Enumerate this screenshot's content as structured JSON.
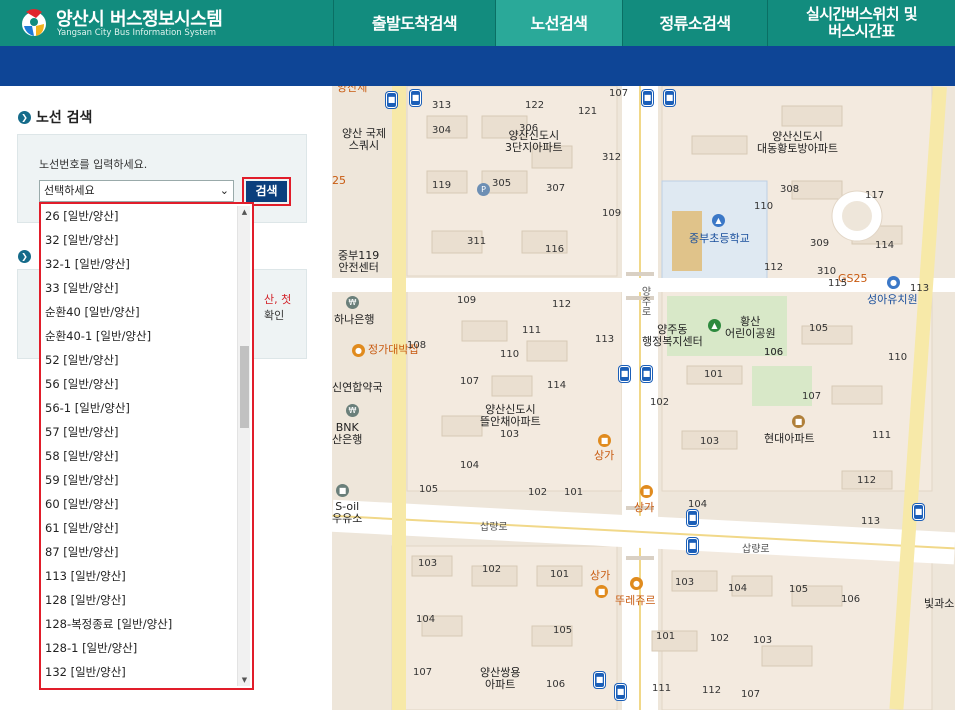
{
  "header": {
    "logo_title": "양산시 버스정보시스템",
    "logo_subtitle": "Yangsan City Bus Information System",
    "nav": [
      {
        "label": "출발도착검색",
        "active": false
      },
      {
        "label": "노선검색",
        "active": true
      },
      {
        "label": "정류소검색",
        "active": false
      },
      {
        "label": "실시간버스위치 및\n버스시간표",
        "active": false
      }
    ]
  },
  "route_search": {
    "section_title": "노선 검색",
    "input_label": "노선번호를 입력하세요.",
    "selected": "선택하세요",
    "search_button": "검색",
    "options": [
      "26 [일반/양산]",
      "32 [일반/양산]",
      "32-1 [일반/양산]",
      "33 [일반/양산]",
      "순환40 [일반/양산]",
      "순환40-1 [일반/양산]",
      "52 [일반/양산]",
      "56 [일반/양산]",
      "56-1 [일반/양산]",
      "57 [일반/양산]",
      "58 [일반/양산]",
      "59 [일반/양산]",
      "60 [일반/양산]",
      "61 [일반/양산]",
      "87 [일반/양산]",
      "113 [일반/양산]",
      "128 [일반/양산]",
      "128-복정종료 [일반/양산]",
      "128-1 [일반/양산]",
      "132 [일반/양산]"
    ]
  },
  "info_box": {
    "line1_red": "산, 첫",
    "line2": "확인"
  },
  "map": {
    "labels": [
      {
        "text": "양산 국제\n스쿼시",
        "cls": "big"
      },
      {
        "text": "양산신도시\n3단지아파트",
        "cls": "big"
      },
      {
        "text": "양산신도시\n대동황토방아파트",
        "cls": "big"
      },
      {
        "text": "중부초등학교",
        "cls": "blue"
      },
      {
        "text": "중부119\n안전센터",
        "cls": "big"
      },
      {
        "text": "하나은행",
        "cls": "big"
      },
      {
        "text": "정가대박집",
        "cls": "orange"
      },
      {
        "text": "양주동\n행정복지센터",
        "cls": "big"
      },
      {
        "text": "황산\n어린이공원",
        "cls": "big"
      },
      {
        "text": "GS25",
        "cls": "orange"
      },
      {
        "text": "성아유치원",
        "cls": "blue"
      },
      {
        "text": "신연합약국",
        "cls": "big"
      },
      {
        "text": "BNK\n산은행",
        "cls": "big"
      },
      {
        "text": "양산신도시\n뜰안채아파트",
        "cls": "big"
      },
      {
        "text": "현대아파트",
        "cls": "big"
      },
      {
        "text": "상가",
        "cls": "orange"
      },
      {
        "text": "상가",
        "cls": "orange"
      },
      {
        "text": "S-oil\n우유소",
        "cls": "big"
      },
      {
        "text": "삽량로",
        "cls": "road"
      },
      {
        "text": "삽량로",
        "cls": "road"
      },
      {
        "text": "상가",
        "cls": "orange"
      },
      {
        "text": "뚜레쥬르",
        "cls": "orange"
      },
      {
        "text": "양산쌍용\n아파트",
        "cls": "big"
      },
      {
        "text": "빛과소",
        "cls": "big"
      },
      {
        "text": "양주로",
        "cls": "road"
      },
      {
        "text": "양산제",
        "cls": "orange"
      },
      {
        "text": "25",
        "cls": "orange"
      }
    ],
    "numbers": [
      "313",
      "122",
      "121",
      "107",
      "304",
      "306",
      "312",
      "119",
      "305",
      "307",
      "308",
      "117",
      "109",
      "110",
      "311",
      "116",
      "309",
      "310",
      "112",
      "115",
      "114",
      "113",
      "109",
      "112",
      "105",
      "111",
      "113",
      "108",
      "110",
      "106",
      "110",
      "107",
      "114",
      "101",
      "107",
      "102",
      "106",
      "103",
      "103",
      "111",
      "104",
      "105",
      "102",
      "101",
      "112",
      "104",
      "113",
      "103",
      "102",
      "101",
      "103",
      "104",
      "105",
      "106",
      "104",
      "105",
      "101",
      "102",
      "103",
      "107",
      "106",
      "111",
      "112",
      "107"
    ]
  }
}
